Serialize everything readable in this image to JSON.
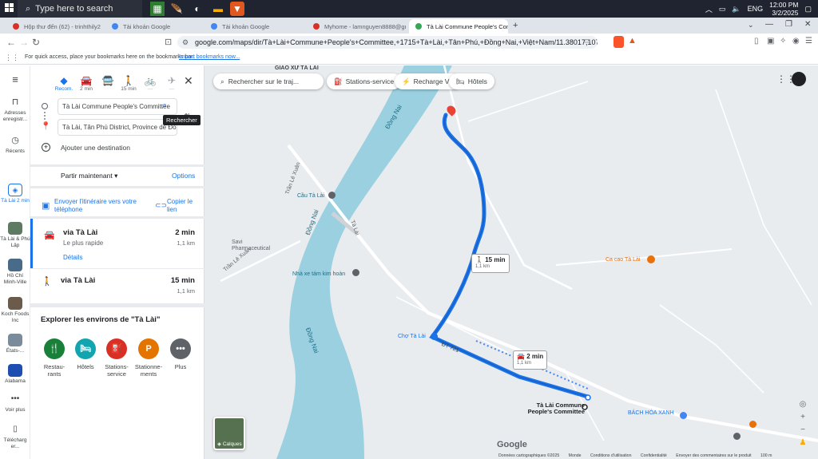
{
  "taskbar": {
    "search_placeholder": "Type here to search",
    "lang": "ENG",
    "time": "12:00 PM",
    "date": "3/2/2025"
  },
  "tabs": [
    {
      "label": "Hộp thư đến (62) - trinhthily2010@...",
      "color": "#d93025"
    },
    {
      "label": "Tài khoản Google",
      "color": "#4285f4"
    },
    {
      "label": "Tài khoản Google",
      "color": "#4285f4"
    },
    {
      "label": "Myhome - lamnguyen8888@gmail...",
      "color": "#d93025"
    },
    {
      "label": "Tà Lài Commune People's Com...",
      "color": "#34a853"
    }
  ],
  "address": {
    "url": "google.com/maps/dir/Tà+Lài+Commune+People's+Committee,+1715+Tà+Lài,+Tân+Phú,+Đồng+Nai,+Việt+Nam/11.38017,107.36441/@11.37...",
    "bookmarks_hint": "For quick access, place your bookmarks here on the bookmarks bar.",
    "bookmarks_link": "Import bookmarks now..."
  },
  "rail": {
    "menu_icon": "menu-icon",
    "items": [
      {
        "label": "Adresses enregistr..."
      },
      {
        "label": "Récents"
      },
      {
        "label": "Tà Lài 2 min"
      },
      {
        "label": "Tà Lài & Phú Lập"
      },
      {
        "label": "Hồ Chí Minh-Ville"
      },
      {
        "label": "Koch Foods Inc"
      },
      {
        "label": "États-..."
      },
      {
        "label": "Alabama"
      },
      {
        "label": "Voir plus"
      },
      {
        "label": "Télécharg er..."
      }
    ]
  },
  "panel": {
    "modes": [
      {
        "label": "Recom.",
        "icon": "diamond-icon"
      },
      {
        "label": "2 min",
        "icon": "car-icon"
      },
      {
        "label": "",
        "icon": "transit-icon"
      },
      {
        "label": "15 min",
        "icon": "walk-icon"
      },
      {
        "label": "—",
        "icon": "bike-icon"
      },
      {
        "label": "—",
        "icon": "plane-icon"
      }
    ],
    "origin": "Tà Lài Commune People's Committee",
    "destination": "Tà Lài, Tân Phú District, Province de Đồng Nai",
    "search_tooltip": "Rechercher",
    "add_destination": "Ajouter une destination",
    "depart": "Partir maintenant",
    "options": "Options",
    "send_phone": "Envoyer l'itinéraire vers votre téléphone",
    "copy_link": "Copier le lien",
    "routes": [
      {
        "title": "via Tà Lài",
        "time": "2 min",
        "sub": "Le plus rapide",
        "dist": "1,1 km",
        "details": "Détails"
      },
      {
        "title": "via Tà Lài",
        "time": "15 min",
        "sub": "",
        "dist": "1,1 km",
        "details": ""
      }
    ],
    "explore_title": "Explorer les environs de \"Tà Lài\"",
    "categories": [
      {
        "label": "Restau-rants",
        "color": "#188038",
        "glyph": "🍴"
      },
      {
        "label": "Hôtels",
        "color": "#12a4af",
        "glyph": "🛏"
      },
      {
        "label": "Stations-service",
        "color": "#d93025",
        "glyph": "⛽"
      },
      {
        "label": "Stationne-ments",
        "color": "#e37400",
        "glyph": "P"
      },
      {
        "label": "Plus",
        "color": "#5f6368",
        "glyph": "•••"
      }
    ]
  },
  "map": {
    "search_placeholder": "Rechercher sur le traj...",
    "chips": [
      "Stations-service",
      "Recharge VE",
      "Hôtels"
    ],
    "labels": {
      "giao_xu": "GIÁO XỨ TÀ LÀI",
      "dong_nai_1": "Đồng Nai",
      "dong_nai_2": "Đồng Nai",
      "dong_nai_3": "Đồng Nai",
      "tran_le_xuan": "Trần Lê Xuân",
      "tran_le_xuan_2": "Trần Lê Xuân",
      "cau_ta_lai": "Cầu Tà Lài",
      "ta_lai_road": "Tà Lài",
      "savi": "Savi Pharmaceutical",
      "nha_xe": "Nhà xe tám kim hoàn",
      "ca_cao": "Ca cao Tà Lài",
      "cho_ta_lai": "Chợ Tà Lài",
      "dt_road": "ĐT 721",
      "committee": "Tà Lài Commune People's Committee",
      "bach_hoa": "BÁCH HÓA XANH",
      "calques": "Calques",
      "google": "Google",
      "footer": [
        "Données cartographiques ©2025",
        "Monde",
        "Conditions d'utilisation",
        "Confidentialité",
        "Envoyer des commentaires sur le produit",
        "100 m"
      ]
    },
    "walk_box": {
      "time": "15 min",
      "dist": "1,1 km"
    },
    "drive_box": {
      "time": "2 min",
      "dist": "1,1 km"
    },
    "route_color": "#1a73e8",
    "water_color": "#9ad0e0",
    "land_color": "#e8eaed"
  }
}
